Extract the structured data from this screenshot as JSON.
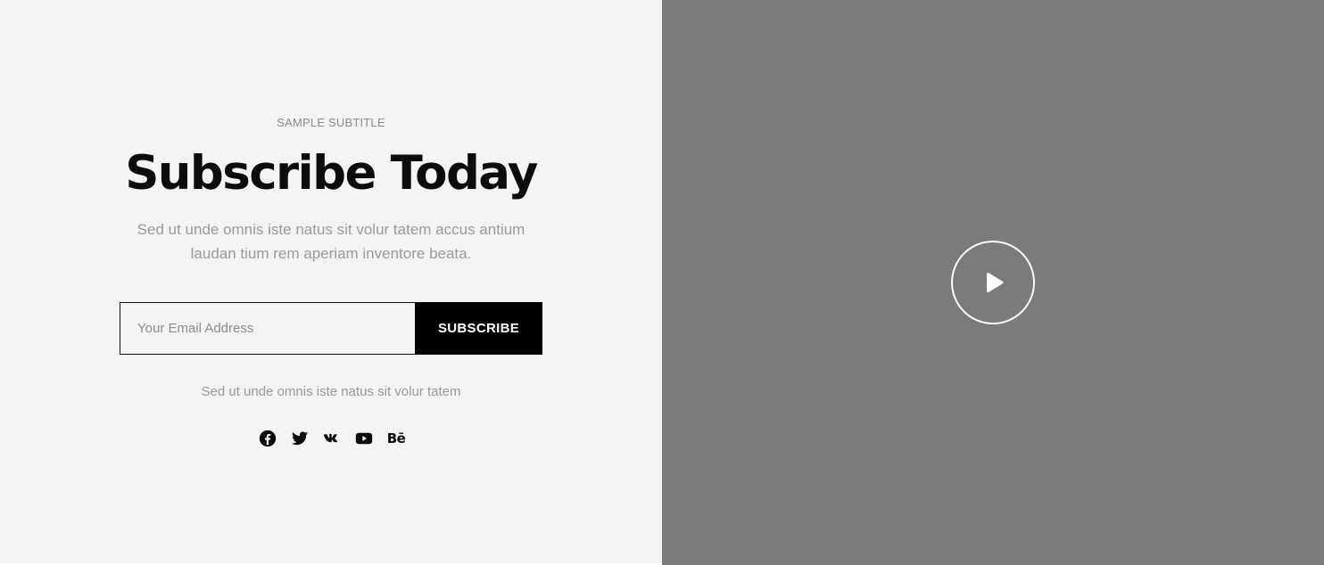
{
  "newsletter": {
    "subtitle": "SAMPLE SUBTITLE",
    "title": "Subscribe Today",
    "description": "Sed ut unde omnis iste natus sit volur tatem accus antium laudan tium rem aperiam inventore beata.",
    "email_placeholder": "Your Email Address",
    "email_value": "",
    "subscribe_label": "SUBSCRIBE",
    "note": "Sed ut unde omnis iste natus sit volur tatem",
    "social": [
      {
        "name": "facebook-icon"
      },
      {
        "name": "twitter-icon"
      },
      {
        "name": "vk-icon"
      },
      {
        "name": "youtube-icon"
      },
      {
        "name": "behance-icon",
        "label": "Bē"
      }
    ]
  },
  "video": {
    "play_icon": "play-icon",
    "background_color": "#7a7b7d"
  },
  "colors": {
    "panel_left": "#f4f4f4",
    "button": "#000000",
    "text_muted": "#9a9a9a"
  }
}
